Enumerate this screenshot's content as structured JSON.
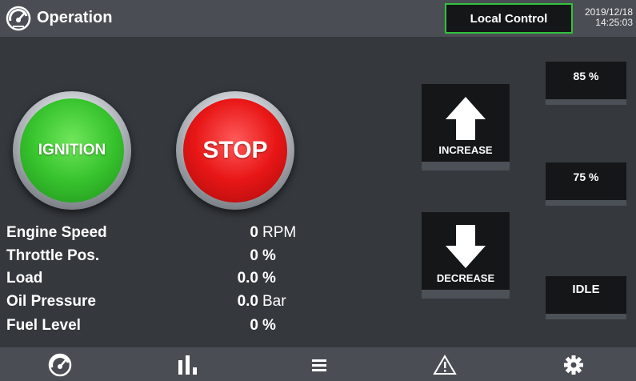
{
  "header": {
    "title": "Operation",
    "mode": "Local Control",
    "date": "2019/12/18",
    "time": "14:25:03"
  },
  "controls": {
    "ignition_label": "IGNITION",
    "stop_label": "STOP",
    "increase_label": "INCREASE",
    "decrease_label": "DECREASE"
  },
  "presets": {
    "high": "85 %",
    "mid": "75 %",
    "idle": "IDLE"
  },
  "readings": [
    {
      "label": "Engine Speed",
      "value": "0",
      "unit": "RPM"
    },
    {
      "label": "Throttle Pos.",
      "value": "0",
      "unit": "%"
    },
    {
      "label": "Load",
      "value": "0.0",
      "unit": "%"
    },
    {
      "label": "Oil Pressure",
      "value": "0.0",
      "unit": "Bar"
    },
    {
      "label": "Fuel Level",
      "value": "0",
      "unit": "%"
    }
  ],
  "footer": {
    "icons": [
      "engine-logo-icon",
      "bar-chart-icon",
      "menu-icon",
      "warning-icon",
      "gear-icon"
    ]
  },
  "colors": {
    "background": "#35393e",
    "header": "#4a4e54",
    "accent_green": "#31c13c",
    "ignition_green": "#38c42e",
    "stop_red": "#e81616",
    "button_dark": "#151618"
  }
}
